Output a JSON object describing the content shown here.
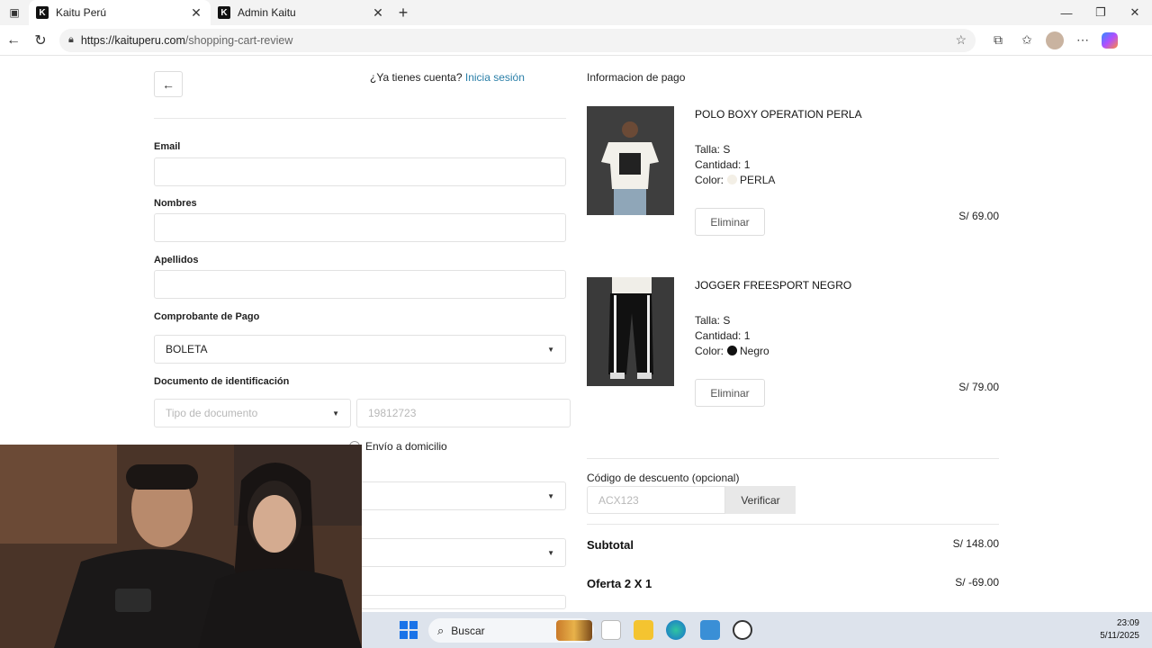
{
  "browser": {
    "tabs": [
      {
        "label": "Kaitu Perú",
        "favicon": "K",
        "active": true
      },
      {
        "label": "Admin Kaitu",
        "favicon": "K",
        "active": false
      }
    ],
    "url_prefix": "https://kaituperu.com",
    "url_path": "/shopping-cart-review"
  },
  "header": {
    "account_question": "¿Ya tienes cuenta?",
    "login_link": "Inicia sesión"
  },
  "form": {
    "email_label": "Email",
    "nombres_label": "Nombres",
    "apellidos_label": "Apellidos",
    "comprobante_label": "Comprobante de Pago",
    "comprobante_value": "BOLETA",
    "documento_label": "Documento de identificación",
    "tipo_documento_placeholder": "Tipo de documento",
    "numero_documento_placeholder": "19812723",
    "delivery_option": "Envío a domicilio"
  },
  "cart": {
    "title": "Informacion de pago",
    "items": [
      {
        "name": "POLO BOXY OPERATION PERLA",
        "talla": "Talla: S",
        "cantidad": "Cantidad: 1",
        "color_prefix": "Color:",
        "color_name": "PERLA",
        "color_hex": "#f3efe6",
        "remove_label": "Eliminar",
        "price": "S/ 69.00"
      },
      {
        "name": "JOGGER FREESPORT NEGRO",
        "talla": "Talla: S",
        "cantidad": "Cantidad: 1",
        "color_prefix": "Color:",
        "color_name": "Negro",
        "color_hex": "#111111",
        "remove_label": "Eliminar",
        "price": "S/ 79.00"
      }
    ],
    "discount_label": "Código de descuento (opcional)",
    "discount_placeholder": "ACX123",
    "verify_label": "Verificar",
    "subtotal_label": "Subtotal",
    "subtotal_value": "S/ 148.00",
    "offer_label": "Oferta 2 X 1",
    "offer_value": "S/ -69.00"
  },
  "taskbar": {
    "search_label": "Buscar",
    "time": "23:09",
    "date": "5/11/2025"
  }
}
